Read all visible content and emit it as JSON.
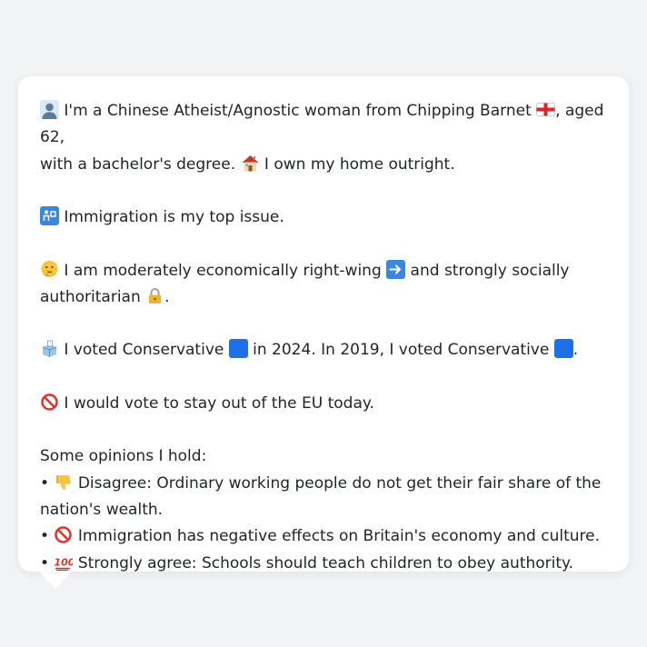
{
  "profile": {
    "intro_a": " I'm a Chinese Atheist/Agnostic woman from Chipping Barnet ",
    "intro_b": ", aged 62,",
    "intro_c": "with a bachelor's degree. ",
    "intro_d": " I own my home outright.",
    "issue": " Immigration is my top issue.",
    "ideology_a": " I am moderately economically right-wing ",
    "ideology_b": " and strongly socially",
    "ideology_c": "authoritarian ",
    "ideology_d": ".",
    "vote_a": " I voted Conservative ",
    "vote_b": " in 2024. In 2019, I voted Conservative ",
    "vote_c": ".",
    "eu": " I would vote to stay out of the EU today.",
    "opinions_heading": "Some opinions I hold:",
    "op1_a": "• ",
    "op1_b": " Disagree: Ordinary working people do not get their fair share of the",
    "op1_c": "nation's wealth.",
    "op2_a": "• ",
    "op2_b": " Immigration has negative effects on Britain's economy and culture.",
    "op3_a": "• ",
    "op3_b": " Strongly agree: Schools should teach children to obey authority."
  },
  "icons": {
    "person": "person-silhouette-icon",
    "flag": "england-flag-icon",
    "home": "house-icon",
    "passport": "passport-control-icon",
    "thinking": "thinking-face-icon",
    "arrow": "right-arrow-icon",
    "lock": "lock-icon",
    "ballot": "ballot-box-icon",
    "party_square": "blue-square-icon",
    "no_entry": "prohibited-icon",
    "thumbs_down": "thumbs-down-icon",
    "hundred": "hundred-points-icon"
  },
  "colors": {
    "background": "#f2f3f5",
    "card": "#ffffff",
    "text": "#1f2328",
    "conservative_blue": "#1d70e8",
    "prohibited_red": "#e0322b"
  }
}
